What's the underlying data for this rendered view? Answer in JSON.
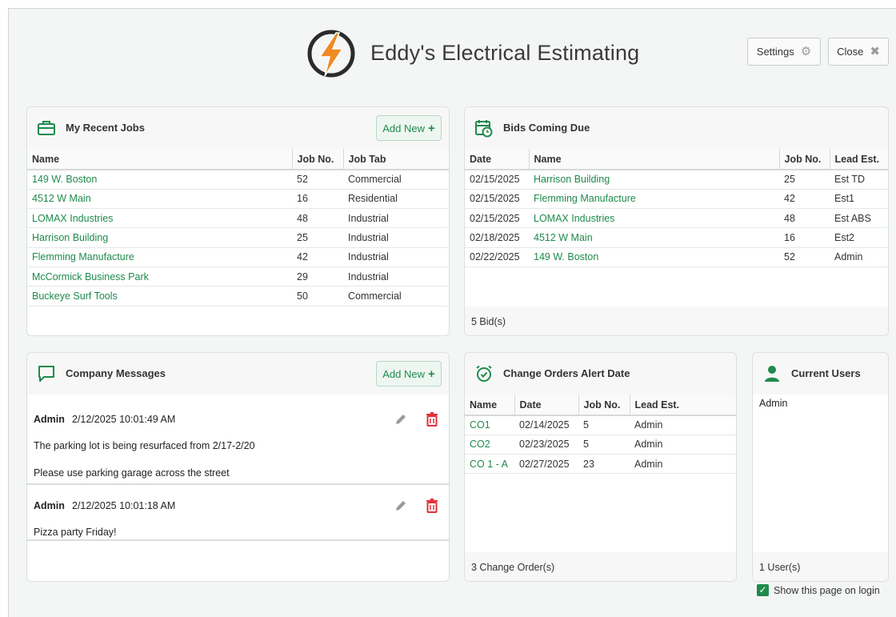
{
  "app": {
    "title": "Eddy's Electrical Estimating"
  },
  "header": {
    "settings_label": "Settings",
    "close_label": "Close"
  },
  "colors": {
    "accent": "#1f8a4c",
    "logo_orange": "#f08a24",
    "delete_red": "#e2303a"
  },
  "recent_jobs": {
    "title": "My Recent Jobs",
    "add_label": "Add New",
    "columns": [
      "Name",
      "Job No.",
      "Job Tab"
    ],
    "rows": [
      [
        "149 W. Boston",
        "52",
        "Commercial"
      ],
      [
        "4512 W Main",
        "16",
        "Residential"
      ],
      [
        "LOMAX Industries",
        "48",
        "Industrial"
      ],
      [
        "Harrison Building",
        "25",
        "Industrial"
      ],
      [
        "Flemming Manufacture",
        "42",
        "Industrial"
      ],
      [
        "McCormick Business Park",
        "29",
        "Industrial"
      ],
      [
        "Buckeye Surf Tools",
        "50",
        "Commercial"
      ]
    ]
  },
  "bids": {
    "title": "Bids Coming Due",
    "columns": [
      "Date",
      "Name",
      "Job No.",
      "Lead Est."
    ],
    "rows": [
      [
        "02/15/2025",
        "Harrison Building",
        "25",
        "Est TD"
      ],
      [
        "02/15/2025",
        "Flemming Manufacture",
        "42",
        "Est1"
      ],
      [
        "02/15/2025",
        "LOMAX Industries",
        "48",
        "Est ABS"
      ],
      [
        "02/18/2025",
        "4512 W Main",
        "16",
        "Est2"
      ],
      [
        "02/22/2025",
        "149 W. Boston",
        "52",
        "Admin"
      ]
    ],
    "footer": "5  Bid(s)"
  },
  "messages": {
    "title": "Company Messages",
    "add_label": "Add New",
    "items": [
      {
        "author": "Admin",
        "timestamp": "2/12/2025 10:01:49 AM",
        "lines": [
          "The parking lot is being resurfaced from 2/17-2/20",
          "Please use parking garage across the street"
        ]
      },
      {
        "author": "Admin",
        "timestamp": "2/12/2025 10:01:18 AM",
        "lines": [
          "Pizza party Friday!"
        ]
      }
    ]
  },
  "change_orders": {
    "title": "Change Orders Alert Date",
    "columns": [
      "Name",
      "Date",
      "Job No.",
      "Lead Est."
    ],
    "rows": [
      [
        "CO1",
        "02/14/2025",
        "5",
        "Admin"
      ],
      [
        "CO2",
        "02/23/2025",
        "5",
        "Admin"
      ],
      [
        "CO 1 - A",
        "02/27/2025",
        "23",
        "Admin"
      ]
    ],
    "footer": "3  Change Order(s)"
  },
  "users": {
    "title": "Current Users",
    "list": [
      "Admin"
    ],
    "footer": "1  User(s)"
  },
  "show_on_login": {
    "label": "Show this page on login",
    "checked": true
  }
}
